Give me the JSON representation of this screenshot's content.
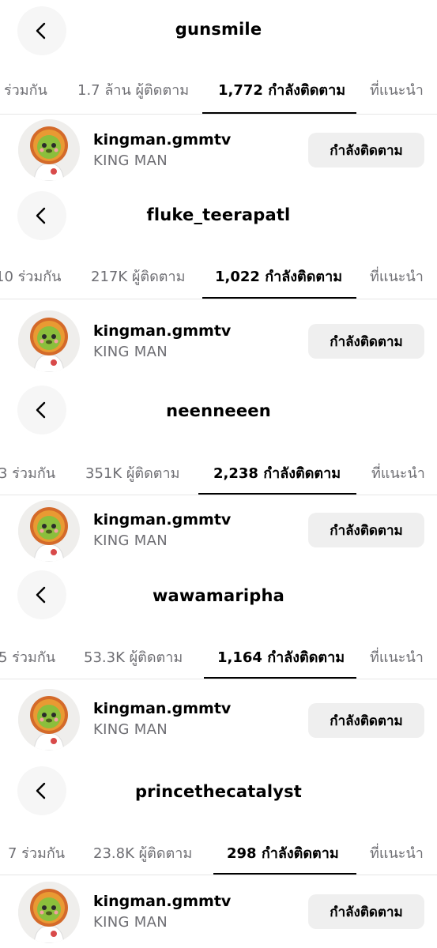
{
  "back_label": "back",
  "accent": "#000000",
  "muted": "#6e6e73",
  "panels": [
    {
      "account": "gunsmile",
      "tabs": [
        "ร่วมกัน",
        "1.7 ล้าน ผู้ติดตาม",
        "1,772 กำลังติดตาม",
        "ที่แนะนำ"
      ],
      "row": {
        "username": "kingman.gmmtv",
        "fullname": "KING MAN",
        "button": "กำลังติดตาม"
      }
    },
    {
      "account": "fluke_teerapatl",
      "tabs": [
        "10 ร่วมกัน",
        "217K ผู้ติดตาม",
        "1,022 กำลังติดตาม",
        "ที่แนะนำ"
      ],
      "row": {
        "username": "kingman.gmmtv",
        "fullname": "KING MAN",
        "button": "กำลังติดตาม"
      }
    },
    {
      "account": "neenneeen",
      "tabs": [
        "3 ร่วมกัน",
        "351K ผู้ติดตาม",
        "2,238 กำลังติดตาม",
        "ที่แนะนำ"
      ],
      "row": {
        "username": "kingman.gmmtv",
        "fullname": "KING MAN",
        "button": "กำลังติดตาม"
      }
    },
    {
      "account": "wawamaripha",
      "tabs": [
        "5 ร่วมกัน",
        "53.3K ผู้ติดตาม",
        "1,164 กำลังติดตาม",
        "ที่แนะนำ"
      ],
      "row": {
        "username": "kingman.gmmtv",
        "fullname": "KING MAN",
        "button": "กำลังติดตาม"
      }
    },
    {
      "account": "princethecatalyst",
      "tabs": [
        "7 ร่วมกัน",
        "23.8K ผู้ติดตาม",
        "298 กำลังติดตาม",
        "ที่แนะนำ"
      ],
      "row": {
        "username": "kingman.gmmtv",
        "fullname": "KING MAN",
        "button": "กำลังติดตาม"
      }
    }
  ]
}
